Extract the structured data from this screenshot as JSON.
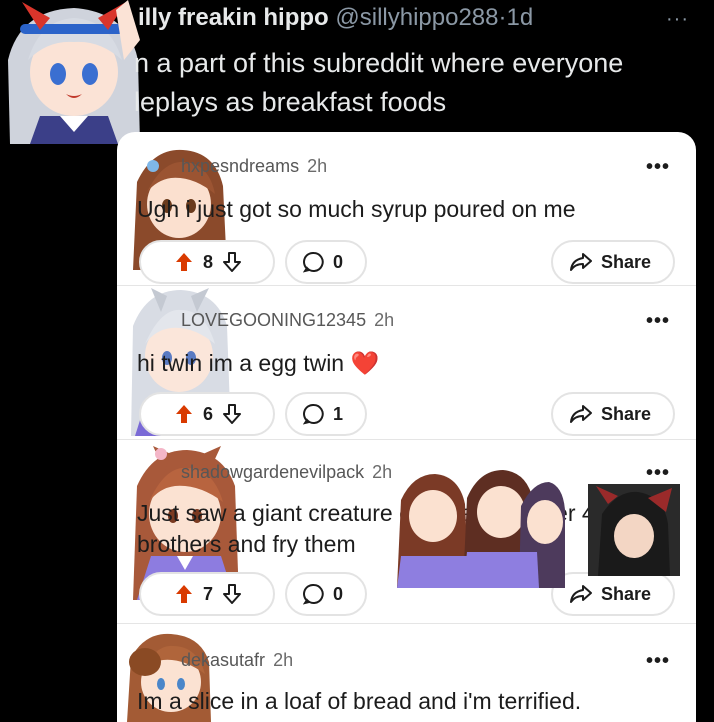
{
  "tweet": {
    "display_name": "illy freakin hippo",
    "handle": "@sillyhippo288",
    "separator": "·",
    "age": "1d",
    "more": "···",
    "text": "n a part of this subreddit where everyone\nleplays as breakfast foods"
  },
  "comments": [
    {
      "user": "hxpesndreams",
      "time": "2h",
      "body": "Ugh i just got so much syrup poured on me",
      "votes": "8",
      "replies": "0",
      "share_label": "Share",
      "more": "•••"
    },
    {
      "user": "LOVEGOONING12345",
      "time": "2h",
      "body": "hi twin im a egg twin ❤️",
      "votes": "6",
      "replies": "1",
      "share_label": "Share",
      "more": "•••"
    },
    {
      "user": "shadowgardenevilpack",
      "time": "2h",
      "body": "Just saw a giant creature crack and shatter 4 of my brothers and fry them",
      "votes": "7",
      "replies": "0",
      "share_label": "Share",
      "more": "•••"
    },
    {
      "user": "dekasutafr",
      "time": "2h",
      "body": "Im a slice in a loaf of bread and i'm terrified.",
      "more": "•••"
    }
  ],
  "colors": {
    "background": "#000000",
    "card": "#ffffff",
    "upvote_active": "#d93a00",
    "heart": "#e0245e"
  },
  "icons": [
    "upvote-icon",
    "downvote-icon",
    "comment-bubble-icon",
    "share-arrow-icon",
    "more-dots-icon"
  ]
}
